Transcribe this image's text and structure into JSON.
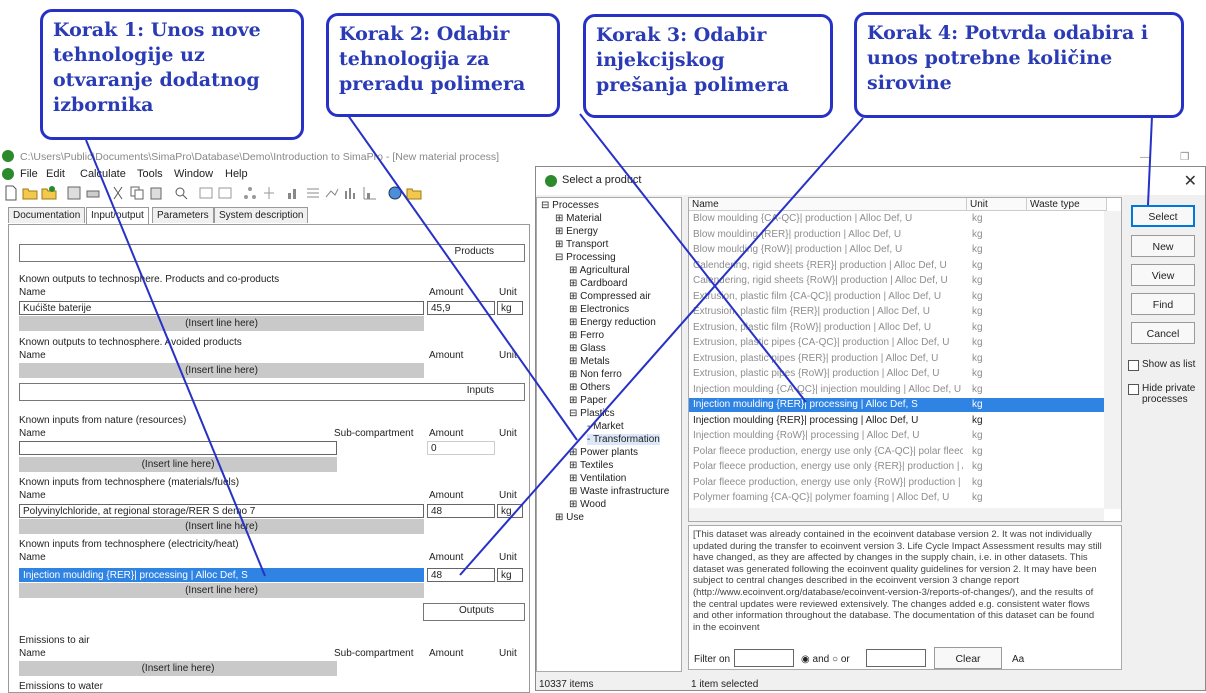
{
  "callouts": [
    {
      "text": "Korak 1: Unos nove tehnologije uz otvaranje dodatnog izbornika"
    },
    {
      "text": "Korak 2: Odabir tehnologija za preradu polimera"
    },
    {
      "text": "Korak 3: Odabir injekcijskog prešanja polimera"
    },
    {
      "text": "Korak 4: Potvrda odabira i unos potrebne količine sirovine"
    }
  ],
  "main_window": {
    "title": "C:\\Users\\Public\\Documents\\SimaPro\\Database\\Demo\\Introduction to SimaPro - [New material process]",
    "menu": [
      "File",
      "Edit",
      "Calculate",
      "Tools",
      "Window",
      "Help"
    ],
    "tabs": [
      "Documentation",
      "Input/output",
      "Parameters",
      "System description"
    ],
    "sections": {
      "products": "Products",
      "inputs": "Inputs",
      "outputs": "Outputs"
    },
    "outputs_products": {
      "heading": "Known outputs to technosphere. Products and co-products",
      "col_name": "Name",
      "col_amount": "Amount",
      "col_unit": "Unit",
      "name": "Kućište baterije",
      "amount": "45,9",
      "unit": "kg"
    },
    "avoided": {
      "heading": "Known outputs to technosphere. Avoided products",
      "col_name": "Name",
      "col_amount": "Amount",
      "col_unit": "Unit"
    },
    "nature": {
      "heading": "Known inputs from nature (resources)",
      "col_name": "Name",
      "col_sub": "Sub-compartment",
      "col_amount": "Amount",
      "col_unit": "Unit",
      "amount": "0"
    },
    "materials": {
      "heading": "Known inputs from technosphere (materials/fuels)",
      "col_name": "Name",
      "col_amount": "Amount",
      "col_unit": "Unit",
      "name": "Polyvinylchloride, at regional storage/RER S demo 7",
      "amount": "48",
      "unit": "kg"
    },
    "electricity": {
      "heading": "Known inputs from technosphere (electricity/heat)",
      "col_name": "Name",
      "col_amount": "Amount",
      "col_unit": "Unit",
      "name": "Injection moulding {RER}| processing | Alloc Def, S",
      "amount": "48",
      "unit": "kg"
    },
    "emissions_air": {
      "heading": "Emissions to air",
      "col_name": "Name",
      "col_sub": "Sub-compartment",
      "col_amount": "Amount",
      "col_unit": "Unit"
    },
    "emissions_water": {
      "heading": "Emissions to water"
    },
    "insert_line": "(Insert line here)"
  },
  "dialog": {
    "title": "Select a product",
    "tree": [
      {
        "label": "Processes",
        "sign": "−"
      },
      {
        "label": "Material",
        "sign": "+"
      },
      {
        "label": "Energy",
        "sign": "+"
      },
      {
        "label": "Transport",
        "sign": "+"
      },
      {
        "label": "Processing",
        "sign": "−"
      },
      {
        "label": "Agricultural",
        "sign": "+"
      },
      {
        "label": "Cardboard",
        "sign": "+"
      },
      {
        "label": "Compressed air",
        "sign": "+"
      },
      {
        "label": "Electronics",
        "sign": "+"
      },
      {
        "label": "Energy reduction",
        "sign": "+"
      },
      {
        "label": "Ferro",
        "sign": "+"
      },
      {
        "label": "Glass",
        "sign": "+"
      },
      {
        "label": "Metals",
        "sign": "+"
      },
      {
        "label": "Non ferro",
        "sign": "+"
      },
      {
        "label": "Others",
        "sign": "+"
      },
      {
        "label": "Paper",
        "sign": "+"
      },
      {
        "label": "Plastics",
        "sign": "−"
      },
      {
        "label": "Market",
        "sign": ""
      },
      {
        "label": "Transformation",
        "sign": ""
      },
      {
        "label": "Power plants",
        "sign": "+"
      },
      {
        "label": "Textiles",
        "sign": "+"
      },
      {
        "label": "Ventilation",
        "sign": "+"
      },
      {
        "label": "Waste infrastructure",
        "sign": "+"
      },
      {
        "label": "Wood",
        "sign": "+"
      },
      {
        "label": "Use",
        "sign": "+"
      }
    ],
    "columns": {
      "name": "Name",
      "unit": "Unit",
      "waste_type": "Waste type"
    },
    "rows": [
      {
        "name": "Blow moulding {CA-QC}| production | Alloc Def, U",
        "unit": "kg"
      },
      {
        "name": "Blow moulding {RER}| production | Alloc Def, U",
        "unit": "kg"
      },
      {
        "name": "Blow moulding {RoW}| production | Alloc Def, U",
        "unit": "kg"
      },
      {
        "name": "Calendering, rigid sheets {RER}| production | Alloc Def, U",
        "unit": "kg"
      },
      {
        "name": "Calendering, rigid sheets {RoW}| production | Alloc Def, U",
        "unit": "kg"
      },
      {
        "name": "Extrusion, plastic film {CA-QC}| production | Alloc Def, U",
        "unit": "kg"
      },
      {
        "name": "Extrusion, plastic film {RER}| production | Alloc Def, U",
        "unit": "kg"
      },
      {
        "name": "Extrusion, plastic film {RoW}| production | Alloc Def, U",
        "unit": "kg"
      },
      {
        "name": "Extrusion, plastic pipes {CA-QC}| production | Alloc Def, U",
        "unit": "kg"
      },
      {
        "name": "Extrusion, plastic pipes {RER}| production | Alloc Def, U",
        "unit": "kg"
      },
      {
        "name": "Extrusion, plastic pipes {RoW}| production | Alloc Def, U",
        "unit": "kg"
      },
      {
        "name": "Injection moulding {CA-QC}| injection moulding | Alloc Def, U",
        "unit": "kg"
      },
      {
        "name": "Injection moulding {RER}| processing | Alloc Def, S",
        "unit": "kg"
      },
      {
        "name": "Injection moulding {RER}| processing | Alloc Def, U",
        "unit": "kg"
      },
      {
        "name": "Injection moulding {RoW}| processing | Alloc Def, U",
        "unit": "kg"
      },
      {
        "name": "Polar fleece production, energy use only {CA-QC}| polar fleece",
        "unit": "kg"
      },
      {
        "name": "Polar fleece production, energy use only {RER}| production | A",
        "unit": "kg"
      },
      {
        "name": "Polar fleece production, energy use only {RoW}| production | A",
        "unit": "kg"
      },
      {
        "name": "Polymer foaming {CA-QC}| polymer foaming | Alloc Def, U",
        "unit": "kg"
      }
    ],
    "description": "[This dataset was already contained in the ecoinvent database version 2. It was not individually updated during the transfer to ecoinvent version 3. Life Cycle Impact Assessment results may still have changed, as they are affected by changes in the supply chain, i.e. in other datasets. This dataset was generated following the ecoinvent quality guidelines for version 2. It may have been subject to central changes described in the ecoinvent version 3 change report (http://www.ecoinvent.org/database/ecoinvent-version-3/reports-of-changes/), and the results of the central updates were reviewed extensively. The changes added e.g. consistent water flows and other information throughout the database. The documentation of this dataset can be found in the ecoinvent",
    "filter_on": "Filter on",
    "and": "and",
    "or": "or",
    "clear": "Clear",
    "aa": "Aa",
    "buttons": {
      "select": "Select",
      "new": "New",
      "view": "View",
      "find": "Find",
      "cancel": "Cancel"
    },
    "show_as_list": "Show as list",
    "hide_private": "Hide private processes",
    "status_items": "10337 items",
    "status_selected": "1 item selected"
  }
}
